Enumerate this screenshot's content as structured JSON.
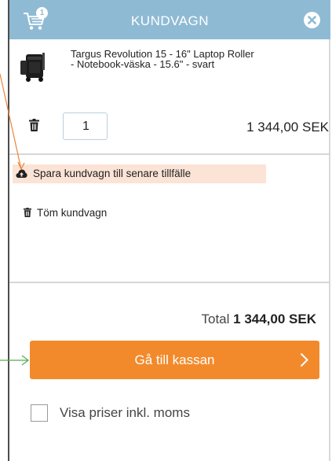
{
  "header": {
    "title": "KUNDVAGN",
    "cart_count": "1"
  },
  "item": {
    "name": "Targus Revolution 15 - 16\" Laptop Roller - Notebook-väska - 15.6\" - svart",
    "quantity": "1",
    "price": "1 344,00 SEK"
  },
  "actions": {
    "save_cart": "Spara kundvagn till senare tillfälle",
    "empty_cart": "Töm kundvagn"
  },
  "summary": {
    "total_label": "Total",
    "total_value": "1 344,00 SEK",
    "checkout_label": "Gå till kassan",
    "vat_label": "Visa priser inkl. moms"
  },
  "colors": {
    "header": "#8fbad4",
    "checkout": "#f28a2c",
    "save_highlight": "#fbe3d6"
  },
  "icons": [
    "cart-icon",
    "close-icon",
    "trash-icon",
    "cloud-upload-icon",
    "chevron-right-icon"
  ]
}
